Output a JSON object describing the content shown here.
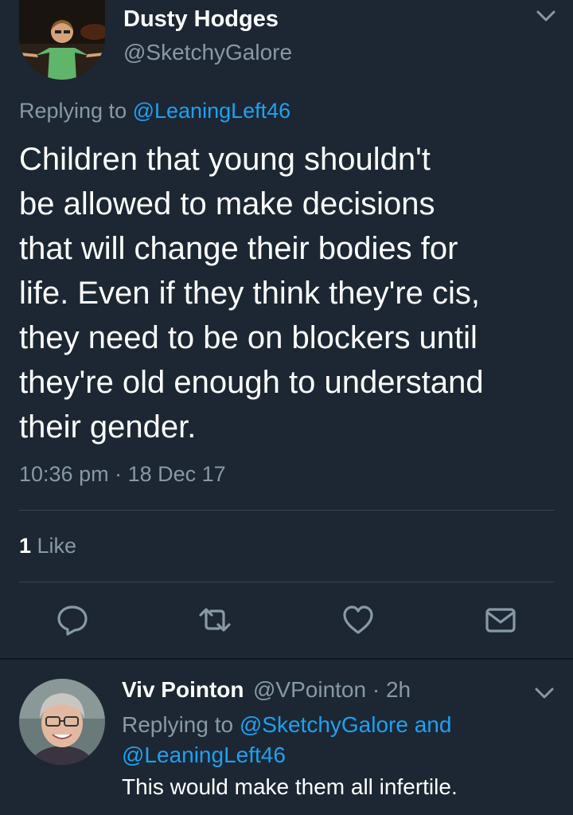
{
  "main_tweet": {
    "author": {
      "display_name": "Dusty Hodges",
      "handle": "@SketchyGalore"
    },
    "replying_prefix": "Replying to ",
    "replying_to": "@LeaningLeft46",
    "text_lines": [
      "Children that young shouldn't",
      "be allowed to make decisions",
      "that will change their bodies for",
      "life. Even if they think they're cis,",
      "they need to be on blockers until",
      "they're old enough to understand",
      "their gender."
    ],
    "timestamp": "10:36 pm · 18 Dec 17",
    "like_count": "1",
    "like_label": " Like",
    "actions": [
      "reply-icon",
      "retweet-icon",
      "like-icon",
      "dm-icon"
    ]
  },
  "reply_tweet": {
    "author": {
      "display_name": "Viv Pointon",
      "handle": "@VPointon",
      "time": " · 2h"
    },
    "replying_prefix": "Replying to ",
    "replying_to_1": "@SketchyGalore",
    "replying_and": " and",
    "replying_to_2": "@LeaningLeft46",
    "text": "This would make them all infertile."
  },
  "colors": {
    "background": "#1c2733",
    "text_primary": "#ffffff",
    "text_secondary": "#8899a6",
    "link": "#1da1f2",
    "divider": "#38444d"
  }
}
